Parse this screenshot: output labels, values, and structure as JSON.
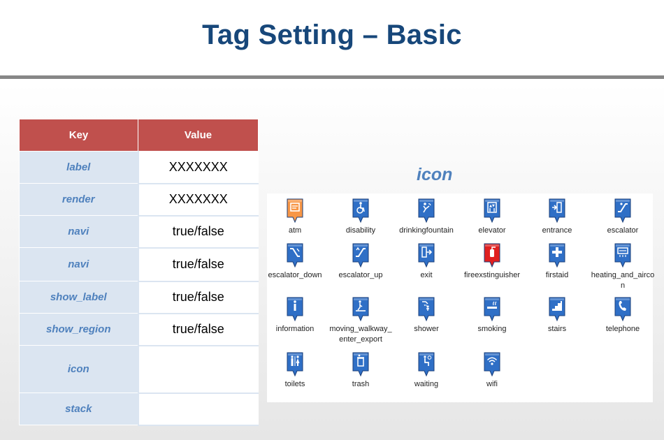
{
  "title": "Tag Setting – Basic",
  "table": {
    "headers": {
      "key": "Key",
      "value": "Value"
    },
    "rows": [
      {
        "key": "label",
        "value": "XXXXXXX"
      },
      {
        "key": "render",
        "value": "XXXXXXX"
      },
      {
        "key": "navi",
        "value": "true/false"
      },
      {
        "key": "navi",
        "value": "true/false"
      },
      {
        "key": "show_label",
        "value": "true/false"
      },
      {
        "key": "show_region",
        "value": "true/false"
      },
      {
        "key": "icon",
        "value": ""
      },
      {
        "key": "stack",
        "value": ""
      }
    ]
  },
  "icon_section": {
    "heading": "icon",
    "icons": [
      {
        "label": "atm",
        "icon": "atm-icon",
        "color": "#f79646"
      },
      {
        "label": "disability",
        "icon": "wheelchair-icon",
        "color": "#2f6fc6"
      },
      {
        "label": "drinkingfountain",
        "icon": "drinking-fountain-icon",
        "color": "#2f6fc6"
      },
      {
        "label": "elevator",
        "icon": "elevator-icon",
        "color": "#2f6fc6"
      },
      {
        "label": "entrance",
        "icon": "entrance-icon",
        "color": "#2f6fc6"
      },
      {
        "label": "escalator",
        "icon": "escalator-icon",
        "color": "#2f6fc6"
      },
      {
        "label": "escalator_down",
        "icon": "escalator-down-icon",
        "color": "#2f6fc6"
      },
      {
        "label": "escalator_up",
        "icon": "escalator-up-icon",
        "color": "#2f6fc6"
      },
      {
        "label": "exit",
        "icon": "exit-icon",
        "color": "#2f6fc6"
      },
      {
        "label": "fireexstinguisher",
        "icon": "fire-extinguisher-icon",
        "color": "#e02020"
      },
      {
        "label": "firstaid",
        "icon": "first-aid-icon",
        "color": "#2f6fc6"
      },
      {
        "label": "heating_and_aircon",
        "icon": "heating-aircon-icon",
        "color": "#2f6fc6"
      },
      {
        "label": "information",
        "icon": "information-icon",
        "color": "#2f6fc6"
      },
      {
        "label": "moving_walkway_enter_export",
        "icon": "moving-walkway-icon",
        "color": "#2f6fc6"
      },
      {
        "label": "shower",
        "icon": "shower-icon",
        "color": "#2f6fc6"
      },
      {
        "label": "smoking",
        "icon": "smoking-icon",
        "color": "#2f6fc6"
      },
      {
        "label": "stairs",
        "icon": "stairs-icon",
        "color": "#2f6fc6"
      },
      {
        "label": "telephone",
        "icon": "telephone-icon",
        "color": "#2f6fc6"
      },
      {
        "label": "toilets",
        "icon": "toilets-icon",
        "color": "#2f6fc6"
      },
      {
        "label": "trash",
        "icon": "trash-icon",
        "color": "#2f6fc6"
      },
      {
        "label": "waiting",
        "icon": "waiting-icon",
        "color": "#2f6fc6"
      },
      {
        "label": "wifi",
        "icon": "wifi-icon",
        "color": "#2f6fc6"
      }
    ]
  }
}
